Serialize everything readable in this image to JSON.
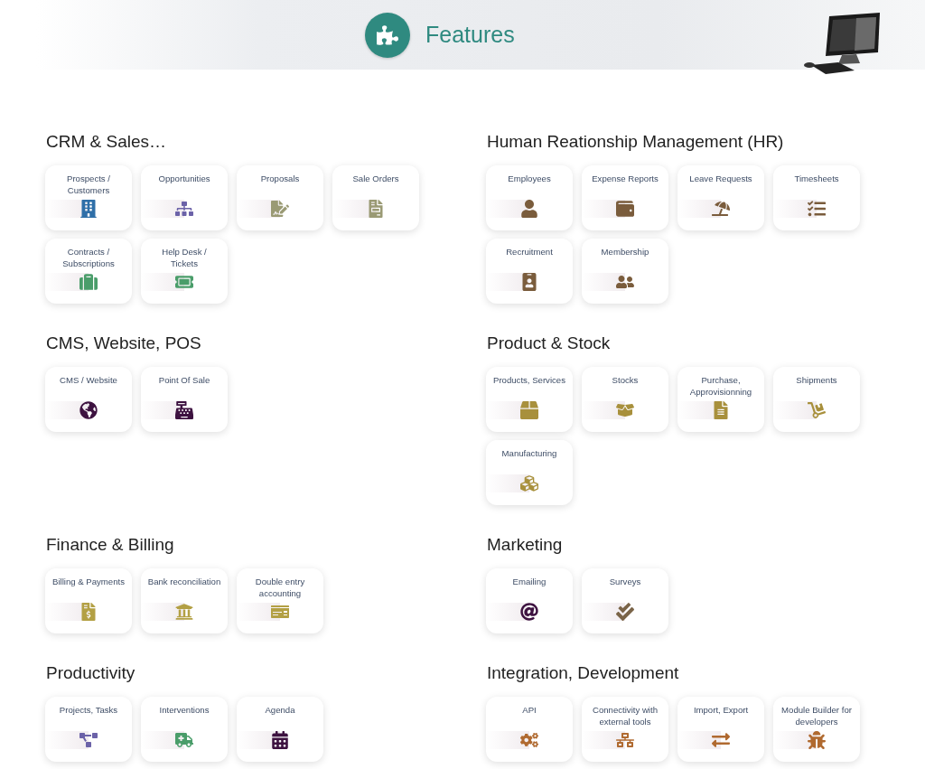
{
  "header": {
    "title": "Features"
  },
  "sections": [
    {
      "title": "CRM & Sales…",
      "items": [
        {
          "label": "Prospects / Customers",
          "color": "#2f6fa8"
        },
        {
          "label": "Opportunities",
          "color": "#6b62a8"
        },
        {
          "label": "Proposals",
          "color": "#9a9a74"
        },
        {
          "label": "Sale Orders",
          "color": "#9a9a74"
        },
        {
          "label": "Contracts / Subscriptions",
          "color": "#4a9d6a"
        },
        {
          "label": "Help Desk / Tickets",
          "color": "#4a9d6a"
        }
      ]
    },
    {
      "title": "Human Reationship Management (HR)",
      "items": [
        {
          "label": "Employees",
          "color": "#7a5c3c"
        },
        {
          "label": "Expense Reports",
          "color": "#7a5c3c"
        },
        {
          "label": "Leave Requests",
          "color": "#7a5c3c"
        },
        {
          "label": "Timesheets",
          "color": "#7a5c3c"
        },
        {
          "label": "Recruitment",
          "color": "#7a5c3c"
        },
        {
          "label": "Membership",
          "color": "#7a5c3c"
        }
      ]
    },
    {
      "title": "CMS, Website, POS",
      "items": [
        {
          "label": "CMS / Website",
          "color": "#3d1240"
        },
        {
          "label": "Point Of Sale",
          "color": "#3d1240"
        }
      ]
    },
    {
      "title": "Product & Stock",
      "items": [
        {
          "label": "Products, Services",
          "color": "#a8903c"
        },
        {
          "label": "Stocks",
          "color": "#a8903c"
        },
        {
          "label": "Purchase, Approvisionning",
          "color": "#a8903c"
        },
        {
          "label": "Shipments",
          "color": "#a8903c"
        },
        {
          "label": "Manufacturing",
          "color": "#a8903c"
        }
      ]
    },
    {
      "title": "Finance & Billing",
      "items": [
        {
          "label": "Billing & Payments",
          "color": "#b3a044"
        },
        {
          "label": "Bank reconciliation",
          "color": "#b3a044"
        },
        {
          "label": "Double entry accounting",
          "color": "#b3a044"
        }
      ]
    },
    {
      "title": "Marketing",
      "items": [
        {
          "label": "Emailing",
          "color": "#3d1240"
        },
        {
          "label": "Surveys",
          "color": "#7a6448"
        }
      ]
    },
    {
      "title": "Productivity",
      "items": [
        {
          "label": "Projects, Tasks",
          "color": "#6b62a8"
        },
        {
          "label": "Interventions",
          "color": "#4a9d6a"
        },
        {
          "label": "Agenda",
          "color": "#3d1240"
        }
      ]
    },
    {
      "title": "Integration, Development",
      "items": [
        {
          "label": "API",
          "color": "#b06a30"
        },
        {
          "label": "Connectivity with external tools",
          "color": "#b06a30"
        },
        {
          "label": "Import, Export",
          "color": "#b06a30"
        },
        {
          "label": "Module Builder for developers",
          "color": "#b06a30"
        }
      ]
    }
  ]
}
